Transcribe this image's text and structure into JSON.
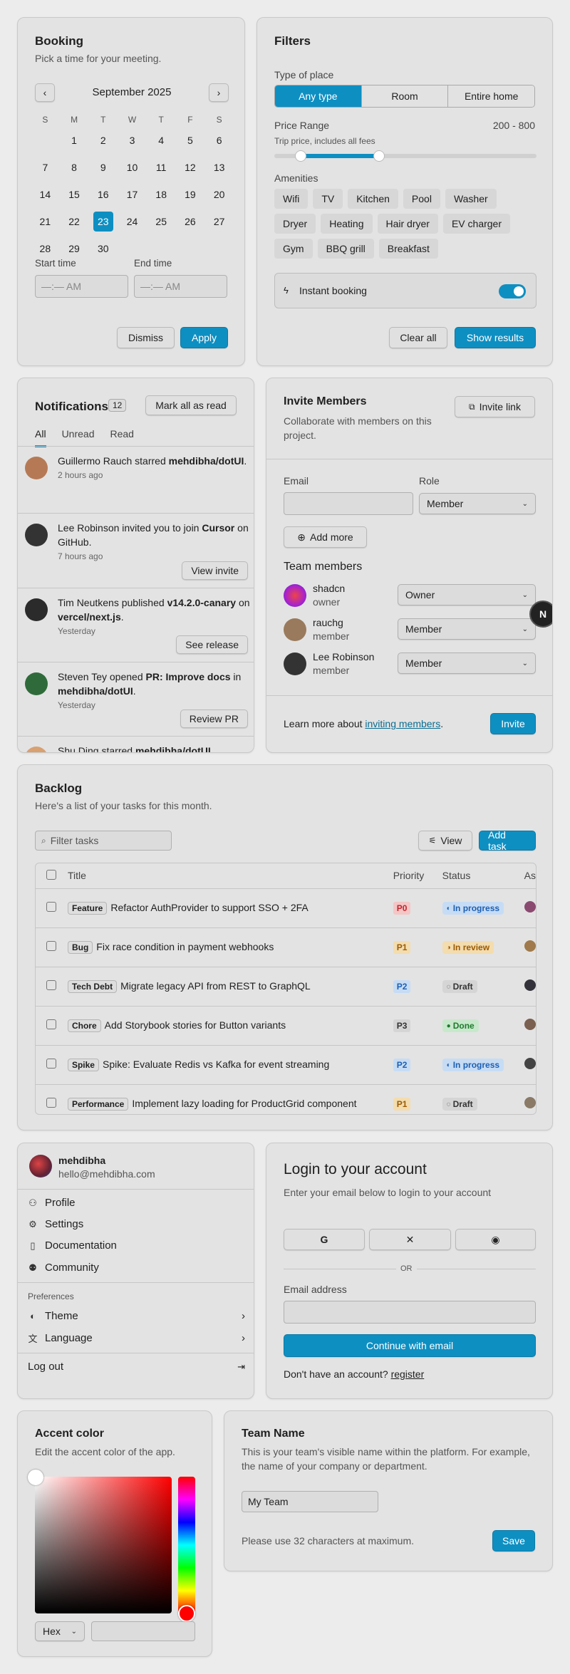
{
  "booking": {
    "title": "Booking",
    "subtitle": "Pick a time for your meeting.",
    "month": "September 2025",
    "weekdays": [
      "S",
      "M",
      "T",
      "W",
      "T",
      "F",
      "S"
    ],
    "days": [
      "",
      "1",
      "2",
      "3",
      "4",
      "5",
      "6",
      "7",
      "8",
      "9",
      "10",
      "11",
      "12",
      "13",
      "14",
      "15",
      "16",
      "17",
      "18",
      "19",
      "20",
      "21",
      "22",
      "23",
      "24",
      "25",
      "26",
      "27",
      "28",
      "29",
      "30"
    ],
    "selected_day": "23",
    "start_label": "Start time",
    "end_label": "End time",
    "time_placeholder": "—:— AM",
    "dismiss": "Dismiss",
    "apply": "Apply"
  },
  "filters": {
    "title": "Filters",
    "type_label": "Type of place",
    "types": [
      "Any type",
      "Room",
      "Entire home"
    ],
    "selected_type": "Any type",
    "price_label": "Price Range",
    "price_value": "200 - 800",
    "price_hint": "Trip price, includes all fees",
    "price_min": 200,
    "price_max": 800,
    "amenities_label": "Amenities",
    "amenities": [
      "Wifi",
      "TV",
      "Kitchen",
      "Pool",
      "Washer",
      "Dryer",
      "Heating",
      "Hair dryer",
      "EV charger",
      "Gym",
      "BBQ grill",
      "Breakfast"
    ],
    "instant_label": "Instant booking",
    "instant_on": true,
    "clear": "Clear all",
    "show": "Show results"
  },
  "notifications": {
    "title": "Notifications",
    "count": "12",
    "mark_all": "Mark all as read",
    "tabs": [
      "All",
      "Unread",
      "Read"
    ],
    "items": [
      {
        "pre": "Guillermo Rauch starred ",
        "bold": "mehdibha/dotUI",
        "post": ".",
        "time": "2 hours ago",
        "action": ""
      },
      {
        "pre": "Lee Robinson invited you to join ",
        "bold": "Cursor",
        "post": " on GitHub.",
        "time": "7 hours ago",
        "action": "View invite"
      },
      {
        "pre": "Tim Neutkens published ",
        "bold": "v14.2.0-canary",
        "post": " on ",
        "bold2": "vercel/next.js",
        "post2": ".",
        "time": "Yesterday",
        "action": "See release"
      },
      {
        "pre": "Steven Tey opened ",
        "bold": "PR: Improve docs",
        "post": " in ",
        "bold2": "mehdibha/dotUI",
        "post2": ".",
        "time": "Yesterday",
        "action": "Review PR"
      },
      {
        "pre": "Shu Ding starred ",
        "bold": "mehdibha/dotUI",
        "post": ".",
        "time": "",
        "action": ""
      }
    ]
  },
  "invite": {
    "title": "Invite Members",
    "subtitle": "Collaborate with members on this project.",
    "invite_link": "Invite link",
    "email_label": "Email",
    "role_label": "Role",
    "role_value": "Member",
    "add_more": "Add more",
    "team_label": "Team members",
    "members": [
      {
        "name": "shadcn",
        "role": "owner",
        "select": "Owner"
      },
      {
        "name": "rauchg",
        "role": "member",
        "select": "Member"
      },
      {
        "name": "Lee Robinson",
        "role": "member",
        "select": "Member"
      }
    ],
    "footer_pre": "Learn more about ",
    "footer_link": "inviting members",
    "footer_post": ".",
    "invite_btn": "Invite",
    "floating": "N"
  },
  "backlog": {
    "title": "Backlog",
    "subtitle": "Here's a list of your tasks for this month.",
    "filter_placeholder": "Filter tasks",
    "view": "View",
    "add": "Add task",
    "columns": [
      "Title",
      "Priority",
      "Status",
      "As"
    ],
    "rows": [
      {
        "tag": "Feature",
        "title": "Refactor AuthProvider to support SSO + 2FA",
        "priority": "P0",
        "status": "In progress"
      },
      {
        "tag": "Bug",
        "title": "Fix race condition in payment webhooks",
        "priority": "P1",
        "status": "In review"
      },
      {
        "tag": "Tech Debt",
        "title": "Migrate legacy API from REST to GraphQL",
        "priority": "P2",
        "status": "Draft"
      },
      {
        "tag": "Chore",
        "title": "Add Storybook stories for Button variants",
        "priority": "P3",
        "status": "Done"
      },
      {
        "tag": "Spike",
        "title": "Spike: Evaluate Redis vs Kafka for event streaming",
        "priority": "P2",
        "status": "In progress"
      },
      {
        "tag": "Performance",
        "title": "Implement lazy loading for ProductGrid component",
        "priority": "P1",
        "status": "Draft"
      }
    ]
  },
  "account": {
    "name": "mehdibha",
    "email": "hello@mehdibha.com",
    "items": [
      "Profile",
      "Settings",
      "Documentation",
      "Community"
    ],
    "prefs_label": "Preferences",
    "theme": "Theme",
    "language": "Language",
    "logout": "Log out"
  },
  "login": {
    "title": "Login to your account",
    "subtitle": "Enter your email below to login to your account",
    "or": "OR",
    "email_label": "Email address",
    "continue": "Continue with email",
    "no_account": "Don't have an account? ",
    "register": "register"
  },
  "accent": {
    "title": "Accent color",
    "subtitle": "Edit the accent color of the app.",
    "format": "Hex"
  },
  "team": {
    "title": "Team Name",
    "subtitle": "This is your team's visible name within the platform. For example, the name of your company or department.",
    "value": "My Team",
    "hint": "Please use 32 characters at maximum.",
    "save": "Save"
  },
  "colors": {
    "accent": "#0e8fc2"
  }
}
